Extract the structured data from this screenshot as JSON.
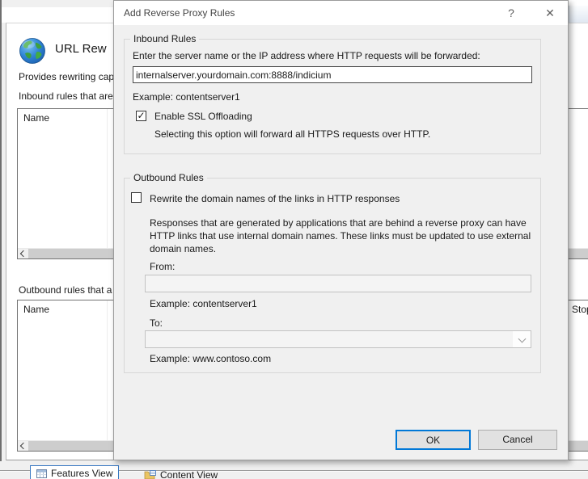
{
  "dialog": {
    "title": "Add Reverse Proxy Rules",
    "help_glyph": "?",
    "close_glyph": "✕",
    "inbound": {
      "legend": "Inbound Rules",
      "instruction": "Enter the server name or the IP address where HTTP requests will be forwarded:",
      "server_value": "internalserver.yourdomain.com:8888/indicium",
      "example": "Example: contentserver1",
      "ssl_label": "Enable SSL Offloading",
      "ssl_checked": true,
      "ssl_check_glyph": "✓",
      "ssl_note": "Selecting this option will forward all HTTPS requests over HTTP."
    },
    "outbound": {
      "legend": "Outbound Rules",
      "rewrite_label": "Rewrite the domain names of the links in HTTP responses",
      "rewrite_checked": false,
      "rewrite_check_glyph": "",
      "description": "Responses that are generated by applications that are behind a reverse proxy can have HTTP links that use internal domain names. These links must be updated to use external domain names.",
      "from_label": "From:",
      "from_value": "",
      "from_example": "Example: contentserver1",
      "to_label": "To:",
      "to_value": "",
      "to_example": "Example: www.contoso.com"
    },
    "buttons": {
      "ok": "OK",
      "cancel": "Cancel"
    }
  },
  "background": {
    "page_title": "URL Rew",
    "description_fragment": "Provides rewriting cap",
    "inbound_list_label": "Inbound rules that are",
    "outbound_list_label": "Outbound rules that a",
    "name_column": "Name",
    "stop_column_fragment": "Stop",
    "tabs": [
      {
        "label": "Features View",
        "selected": true
      },
      {
        "label": "Content View",
        "selected": false
      }
    ]
  },
  "icons": {
    "globe": "url-rewrite-globe",
    "features_view": "grid-table-icon",
    "content_view": "folder-content-icon",
    "scroll_left": "chevron-left-icon",
    "combo": "chevron-down-icon"
  },
  "colors": {
    "accent_blue": "#0078d7",
    "selected_tab_border": "#3a79c2",
    "dialog_bg": "#f0f0f0",
    "titlebar_bg": "#ffffff",
    "button_bg": "#e1e1e1"
  }
}
